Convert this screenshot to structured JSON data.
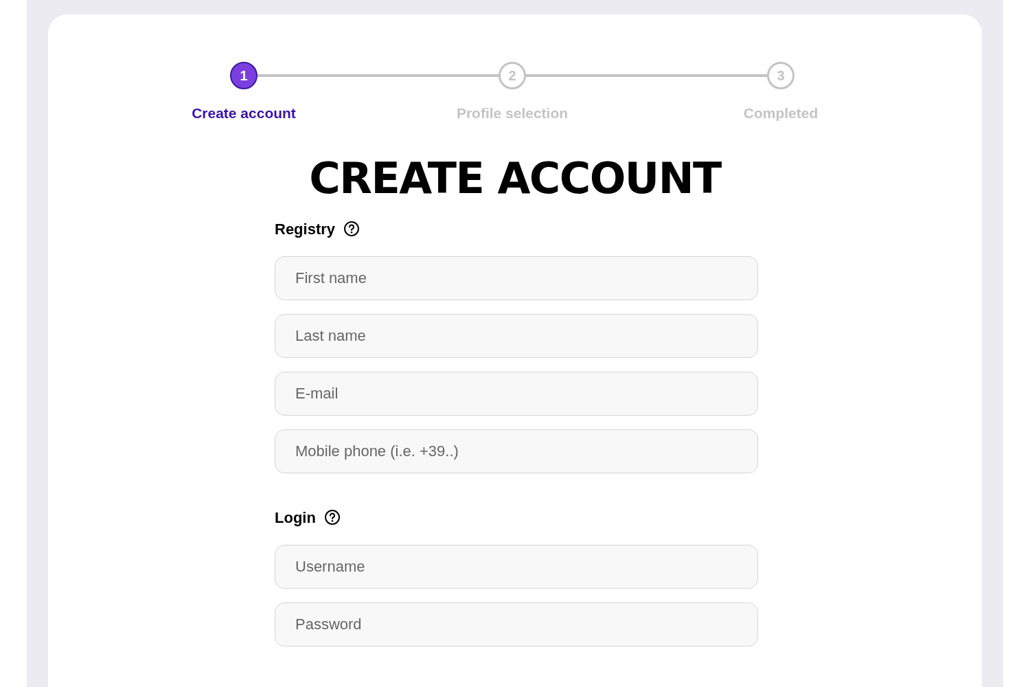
{
  "steps": [
    {
      "number": "1",
      "label": "Create account",
      "selected": true
    },
    {
      "number": "2",
      "label": "Profile selection",
      "selected": false
    },
    {
      "number": "3",
      "label": "Completed",
      "selected": false
    }
  ],
  "title": "CREATE ACCOUNT",
  "sections": [
    {
      "heading": "Registry",
      "fields": [
        {
          "placeholder": "First name"
        },
        {
          "placeholder": "Last name"
        },
        {
          "placeholder": "E-mail"
        },
        {
          "placeholder": "Mobile phone (i.e. +39..)"
        }
      ]
    },
    {
      "heading": "Login",
      "fields": [
        {
          "placeholder": "Username"
        },
        {
          "placeholder": "Password"
        }
      ]
    }
  ]
}
